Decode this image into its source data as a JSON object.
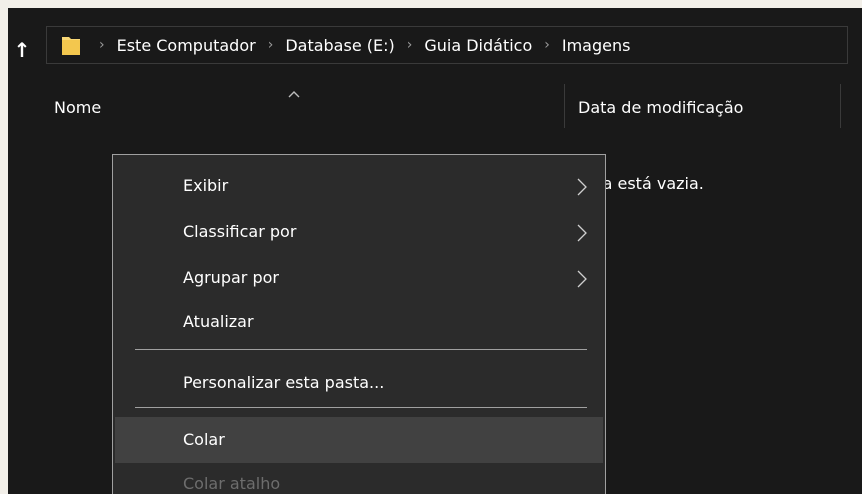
{
  "navigation": {
    "up_icon": "arrow-up-icon",
    "folder_icon": "folder-icon",
    "breadcrumbs": [
      "Este Computador",
      "Database (E:)",
      "Guia Didático",
      "Imagens"
    ]
  },
  "columns": {
    "name": "Nome",
    "date_modified": "Data de modificação",
    "sort_icon": "sort-ascending-icon"
  },
  "content": {
    "empty_message_visible": "sta está vazia."
  },
  "context_menu": {
    "items": [
      {
        "label": "Exibir",
        "has_submenu": true
      },
      {
        "label": "Classificar por",
        "has_submenu": true
      },
      {
        "label": "Agrupar por",
        "has_submenu": true
      },
      {
        "label": "Atualizar",
        "has_submenu": false
      },
      {
        "label": "Personalizar esta pasta...",
        "has_submenu": false
      },
      {
        "label": "Colar",
        "has_submenu": false,
        "highlighted": true
      },
      {
        "label": "Colar atalho",
        "has_submenu": false,
        "disabled": true
      }
    ]
  },
  "colors": {
    "background": "#191919",
    "menu_background": "#2b2b2b",
    "menu_highlight": "#414141",
    "disabled_text": "#6d6d6d",
    "folder_yellow": "#f8d775"
  }
}
